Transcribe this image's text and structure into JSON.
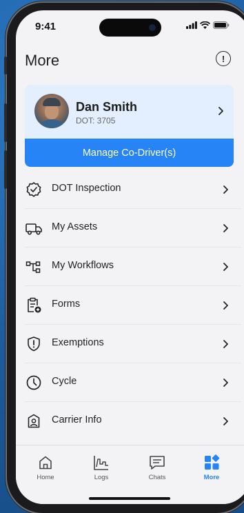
{
  "status_bar": {
    "time": "9:41"
  },
  "page": {
    "title": "More"
  },
  "profile": {
    "name": "Dan Smith",
    "dot": "DOT: 3705"
  },
  "manage_button": {
    "label": "Manage Co-Driver(s)"
  },
  "menu": {
    "items": [
      {
        "label": "DOT Inspection",
        "icon": "badge-check-icon"
      },
      {
        "label": "My Assets",
        "icon": "truck-icon"
      },
      {
        "label": "My Workflows",
        "icon": "workflow-icon"
      },
      {
        "label": "Forms",
        "icon": "clipboard-add-icon"
      },
      {
        "label": "Exemptions",
        "icon": "shield-alert-icon"
      },
      {
        "label": "Cycle",
        "icon": "clock-icon"
      },
      {
        "label": "Carrier Info",
        "icon": "carrier-profile-icon"
      }
    ]
  },
  "tabbar": {
    "tabs": [
      {
        "label": "Home",
        "icon": "home-icon"
      },
      {
        "label": "Logs",
        "icon": "logs-chart-icon"
      },
      {
        "label": "Chats",
        "icon": "chat-icon"
      },
      {
        "label": "More",
        "icon": "grid-icon",
        "active": true
      }
    ]
  },
  "colors": {
    "accent": "#2684f6",
    "profile_bg": "#e3efff",
    "screen_bg": "#f3f3f5"
  }
}
